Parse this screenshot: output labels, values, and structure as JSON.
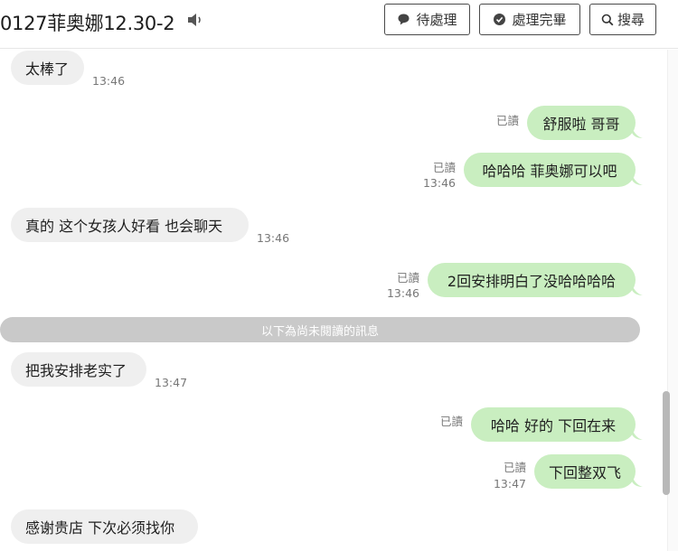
{
  "header": {
    "title": "0127菲奥娜12.30-2",
    "btn_pending": "待處理",
    "btn_done": "處理完畢",
    "btn_search": "搜尋"
  },
  "messages": [
    {
      "side": "in",
      "text": "太棒了",
      "time": "13:46"
    },
    {
      "side": "out",
      "text": "舒服啦 哥哥",
      "read": "已讀",
      "time": ""
    },
    {
      "side": "out",
      "text": "哈哈哈 菲奥娜可以吧",
      "read": "已讀",
      "time": "13:46"
    },
    {
      "side": "in",
      "text": "真的 这个女孩人好看 也会聊天",
      "time": "13:46"
    },
    {
      "side": "out",
      "text": "2回安排明白了没哈哈哈哈",
      "read": "已讀",
      "time": "13:46"
    },
    {
      "side": "in",
      "text": "把我安排老实了",
      "time": "13:47"
    },
    {
      "side": "out",
      "text": "哈哈 好的 下回在来",
      "read": "已讀",
      "time": ""
    },
    {
      "side": "out",
      "text": "下回整双飞",
      "read": "已讀",
      "time": "13:47"
    },
    {
      "side": "in",
      "text": "感谢贵店 下次必须找你",
      "time": ""
    }
  ],
  "unread_divider": "以下為尚未閱讀的訊息",
  "icons": {
    "speaker": "speaker-icon",
    "pending": "speech-bubble-icon",
    "done": "check-circle-icon",
    "search": "search-icon"
  },
  "colors": {
    "incoming_bubble": "#efefef",
    "outgoing_bubble": "#c9eec0",
    "divider": "#c9c9c9"
  }
}
